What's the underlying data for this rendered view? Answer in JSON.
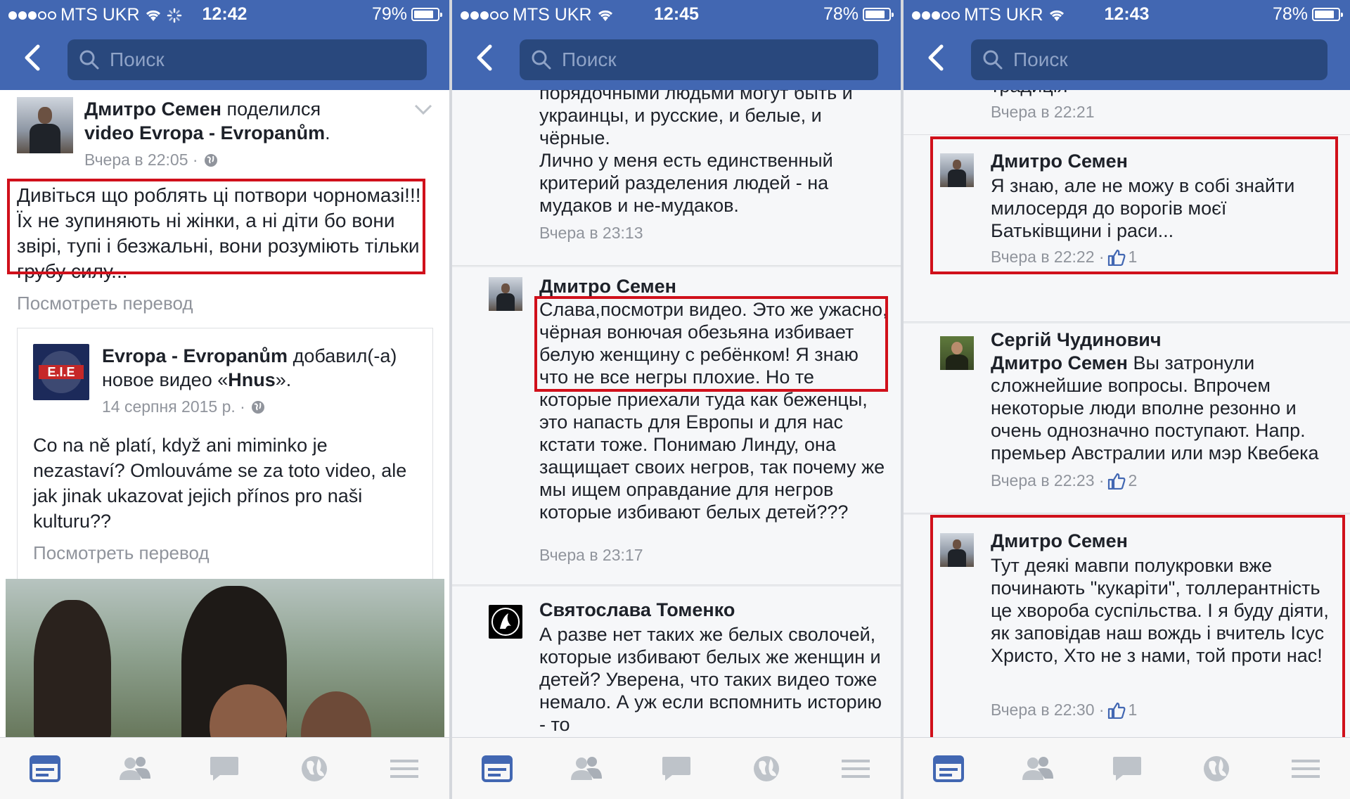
{
  "status": [
    {
      "carrier": "MTS UKR",
      "time": "12:42",
      "battery": "79%",
      "loading": true
    },
    {
      "carrier": "MTS UKR",
      "time": "12:45",
      "battery": "78%",
      "loading": false
    },
    {
      "carrier": "MTS UKR",
      "time": "12:43",
      "battery": "78%",
      "loading": false
    }
  ],
  "search_placeholder": "Поиск",
  "tabs": [
    "news-feed-icon",
    "friends-icon",
    "messages-icon",
    "notifications-globe-icon",
    "more-menu-icon"
  ],
  "accent_color": "#4267b2",
  "highlight_color": "#d0101b",
  "screen1": {
    "post": {
      "author": "Дмитро Семен",
      "action": "поделился",
      "shared": "video Evropa - Evropanům",
      "dot": ".",
      "time": "Вчера в 22:05 ·",
      "text": "Дивіться що роблять ці потвори чорномазі!!! Їх не зупиняють ні жінки, а ні діти бо вони звірі, тупі і безжальні, вони розуміють тільки грубу силу...",
      "translate": "Посмотреть перевод"
    },
    "shared_post": {
      "page_name": "Evropa - Evropanům",
      "action": "добавил(-а) новое видео «",
      "video": "Hnus",
      "action_end": "».",
      "time": "14 серпня 2015 р. ·",
      "text": "Co na ně platí, když ani miminko je nezastaví? Omlouváme se za toto video, ale jak jinak ukazovat jejich přínos pro naši kulturu??",
      "translate": "Посмотреть перевод"
    }
  },
  "screen2": {
    "top_comment_tail": "порядочными людьми могут быть и украинцы, и русские, и белые, и чёрные.\nЛично у меня есть единственный критерий разделения людей - на мудаков и не-мудаков.",
    "top_comment_time": "Вчера в 23:13",
    "comment1": {
      "author": "Дмитро Семен",
      "text": "Слава,посмотри видео. Это же ужасно, чёрная вонючая обезьяна избивает белую женщину с ребёнком! Я знаю что не все негры плохие. Но те которые приехали туда как беженцы, это напасть для Европы и для нас кстати тоже. Понимаю Линду, она защищает своих негров, так почему же мы ищем оправдание для негров которые избивают белых детей???",
      "time": "Вчера в 23:17"
    },
    "comment2": {
      "author": "Святослава Томенко",
      "text": "А разве нет таких же белых сволочей, которые избивают белых же женщин и детей? Уверена, что таких видео тоже немало. А уж если вспомнить историю - то"
    }
  },
  "screen3": {
    "top_tail": "традиція",
    "top_time": "Вчера в 22:21",
    "comment1": {
      "author": "Дмитро Семен",
      "text": "Я знаю, але не можу в собі знайти милосердя до ворогів моєї Батьківщини і раси...",
      "time": "Вчера в 22:22 ·",
      "likes": "1"
    },
    "comment2": {
      "author": "Сергій Чудинович",
      "mention": "Дмитро Семен",
      "text": " Вы затронули сложнейшие вопросы. Впрочем некоторые люди вполне резонно и очень однозначно поступают. Напр. премьер Австралии или мэр Квебека",
      "time": "Вчера в 22:23 ·",
      "likes": "2"
    },
    "comment3": {
      "author": "Дмитро Семен",
      "text": "Тут деякі мавпи полукровки вже починають \"кукаріти\", толлерантність це хвороба суспільства. І я буду діяти, як заповідав наш вождь і вчитель Ісус Христо, Хто не з нами, той проти нас!",
      "time": "Вчера в 22:30 ·",
      "likes": "1"
    }
  }
}
